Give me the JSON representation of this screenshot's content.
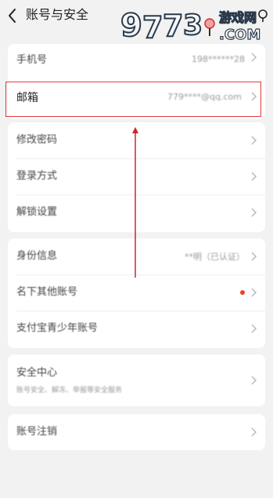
{
  "header": {
    "title": "账号与安全",
    "watermark_text": "9773游戏网 .COM"
  },
  "accent_color": "#e23a3a",
  "sections": [
    {
      "items": [
        {
          "label": "手机号",
          "value": "198******28"
        },
        {
          "label": "邮箱",
          "value": "779****@qq.com"
        }
      ]
    },
    {
      "items": [
        {
          "label": "修改密码"
        },
        {
          "label": "登录方式"
        },
        {
          "label": "解锁设置"
        }
      ]
    },
    {
      "items": [
        {
          "label": "身份信息",
          "value": "**明（已认证）"
        },
        {
          "label": "名下其他账号",
          "badge": "red-dot"
        },
        {
          "label": "支付宝青少年账号"
        }
      ]
    },
    {
      "items": [
        {
          "label": "安全中心",
          "sub": "账号安全、解冻、举报等安全服务"
        }
      ]
    },
    {
      "items": [
        {
          "label": "账号注销"
        }
      ]
    }
  ]
}
